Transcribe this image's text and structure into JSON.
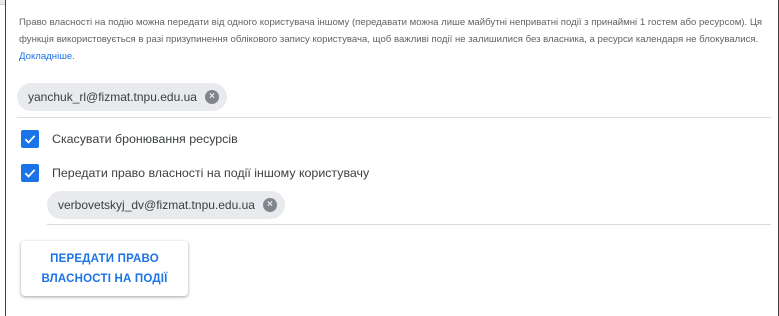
{
  "description": {
    "text": "Право власності на подію можна передати від одного користувача іншому (передавати можна лише майбутні неприватні події з принаймні 1 гостем або ресурсом). Ця функція використовується в разі призупинення облікового запису користувача, щоб важливі події не залишилися без власника, а ресурси календаря не блокувалися.",
    "link_label": "Докладніше."
  },
  "owner_chip": {
    "email": "yanchuk_rl@fizmat.tnpu.edu.ua",
    "remove_glyph": "×"
  },
  "options": [
    {
      "label": "Скасувати бронювання ресурсів",
      "checked": true
    },
    {
      "label": "Передати право власності на події іншому користувачу",
      "checked": true
    }
  ],
  "new_owner_chip": {
    "email": "verbovetskyj_dv@fizmat.tnpu.edu.ua",
    "remove_glyph": "×"
  },
  "action_button": {
    "line1": "ПЕРЕДАТИ ПРАВО",
    "line2": "ВЛАСНОСТІ НА ПОДІЇ"
  },
  "colors": {
    "accent": "#1a73e8",
    "chip_bg": "#e8eaed",
    "text": "#3c4043",
    "muted": "#5f6368"
  },
  "icons": {
    "chip_remove": "cancel-icon",
    "checkbox": "check-icon"
  }
}
